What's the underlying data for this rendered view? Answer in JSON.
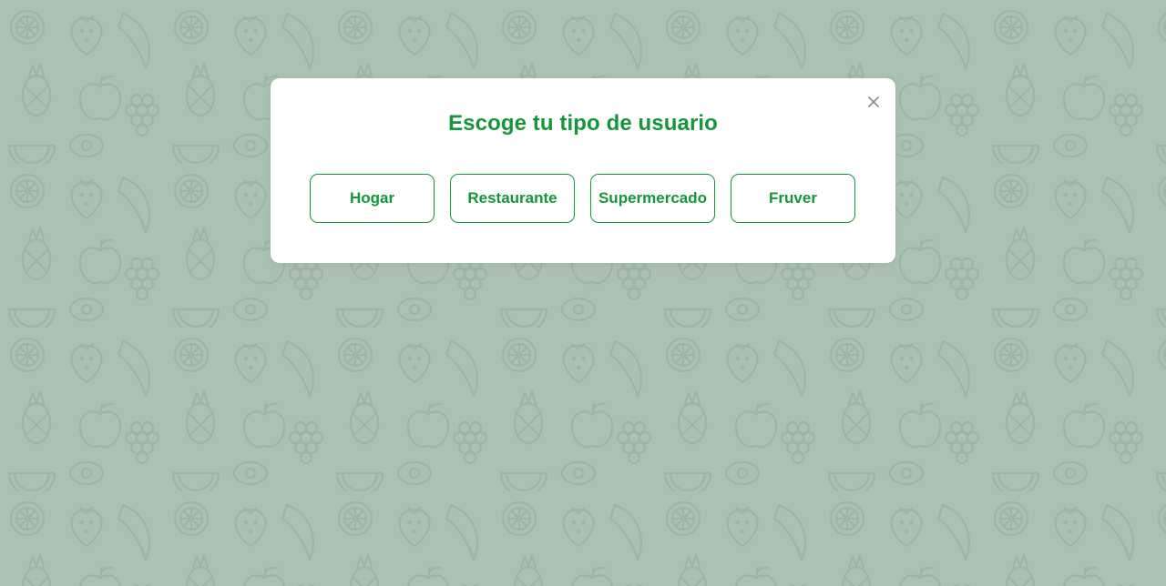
{
  "colors": {
    "brand_green": "#14963a",
    "backdrop": "#abc1b2",
    "pattern_stroke": "#9db5a4",
    "close_icon": "#8a8a8a",
    "modal_bg": "#ffffff"
  },
  "background": {
    "pattern": "fruit-icons",
    "icons": [
      "orange-slice-icon",
      "strawberry-icon",
      "pineapple-icon",
      "banana-icon",
      "grapes-icon",
      "apple-icon",
      "lemon-icon",
      "watermelon-slice-icon",
      "avocado-icon",
      "kiwi-icon",
      "pear-icon",
      "cherry-icon"
    ]
  },
  "modal": {
    "title": "Escoge tu tipo de usuario",
    "close_icon": "close-icon",
    "options": [
      {
        "label": "Hogar"
      },
      {
        "label": "Restaurante"
      },
      {
        "label": "Supermercado"
      },
      {
        "label": "Fruver"
      }
    ]
  }
}
